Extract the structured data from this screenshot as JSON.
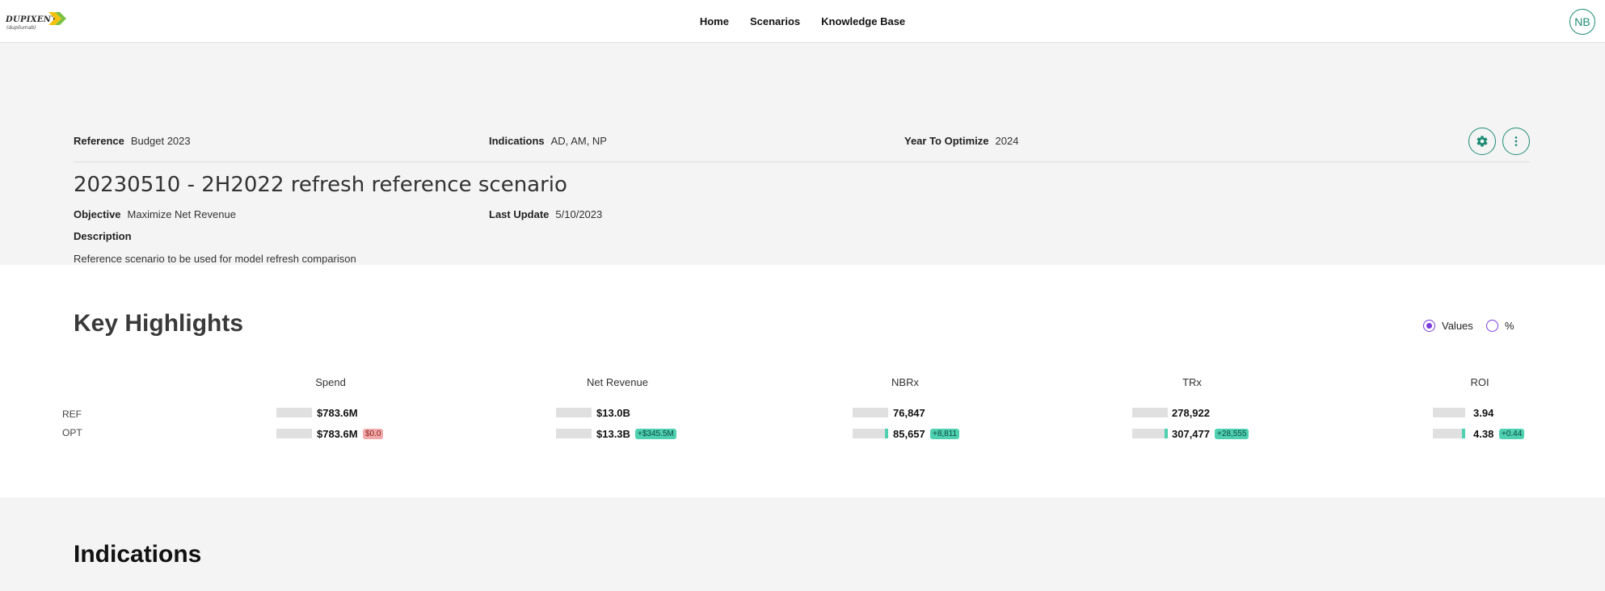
{
  "brand": {
    "name": "Dupixent",
    "sub": "(dupilumab)",
    "chevron_colors": [
      "#f4c20d",
      "#7cc242"
    ]
  },
  "nav": {
    "home": "Home",
    "scenarios": "Scenarios",
    "knowledge_base": "Knowledge Base"
  },
  "user": {
    "initials": "NB"
  },
  "scenario": {
    "reference_label": "Reference",
    "reference_value": "Budget 2023",
    "indications_label": "Indications",
    "indications_value": "AD, AM, NP",
    "year_label": "Year To Optimize",
    "year_value": "2024",
    "settings_icon": "gear-icon",
    "menu_icon": "more-vertical-icon",
    "title": "20230510 - 2H2022 refresh reference scenario",
    "objective_label": "Objective",
    "objective_value": "Maximize Net Revenue",
    "last_update_label": "Last Update",
    "last_update_value": "5/10/2023",
    "description_label": "Description",
    "description_value": "Reference scenario to be used for model refresh comparison"
  },
  "highlights": {
    "title": "Key Highlights",
    "view_options": [
      {
        "label": "Values",
        "selected": true
      },
      {
        "label": "%",
        "selected": false
      }
    ],
    "row_labels": [
      "REF",
      "OPT"
    ],
    "columns": [
      {
        "header": "Spend",
        "ref": "$783.6M",
        "opt": "$783.6M",
        "delta": "$0.0",
        "delta_type": "neg",
        "opt_fill": 0
      },
      {
        "header": "Net Revenue",
        "ref": "$13.0B",
        "opt": "$13.3B",
        "delta": "+$345.5M",
        "delta_type": "pos",
        "opt_fill": 0
      },
      {
        "header": "NBRx",
        "ref": "76,847",
        "opt": "85,657",
        "delta": "+8,811",
        "delta_type": "pos",
        "opt_fill": 1
      },
      {
        "header": "TRx",
        "ref": "278,922",
        "opt": "307,477",
        "delta": "+28,555",
        "delta_type": "pos",
        "opt_fill": 1
      },
      {
        "header": "ROI",
        "ref": "3.94",
        "opt": "4.38",
        "delta": "+0.44",
        "delta_type": "pos",
        "opt_fill": 1
      }
    ],
    "colors": {
      "accent": "#1e8c74",
      "radio": "#7a3ddb",
      "pos_chip": "#4fd0b0",
      "neg_chip": "#f1a9a9"
    }
  },
  "indications_section": {
    "title": "Indications"
  }
}
